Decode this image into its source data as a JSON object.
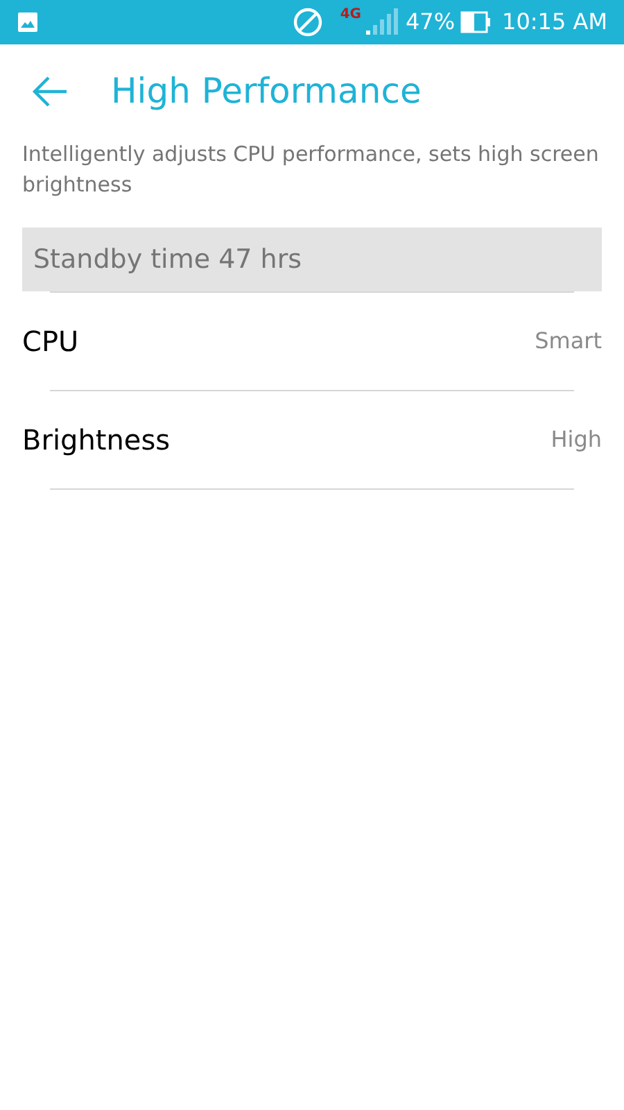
{
  "status_bar": {
    "network": "4G",
    "battery": "47%",
    "time": "10:15 AM"
  },
  "header": {
    "title": "High Performance"
  },
  "description": "Intelligently adjusts CPU performance, sets high screen brightness",
  "standby": "Standby time 47 hrs",
  "settings": [
    {
      "label": "CPU",
      "value": "Smart"
    },
    {
      "label": "Brightness",
      "value": "High"
    }
  ]
}
